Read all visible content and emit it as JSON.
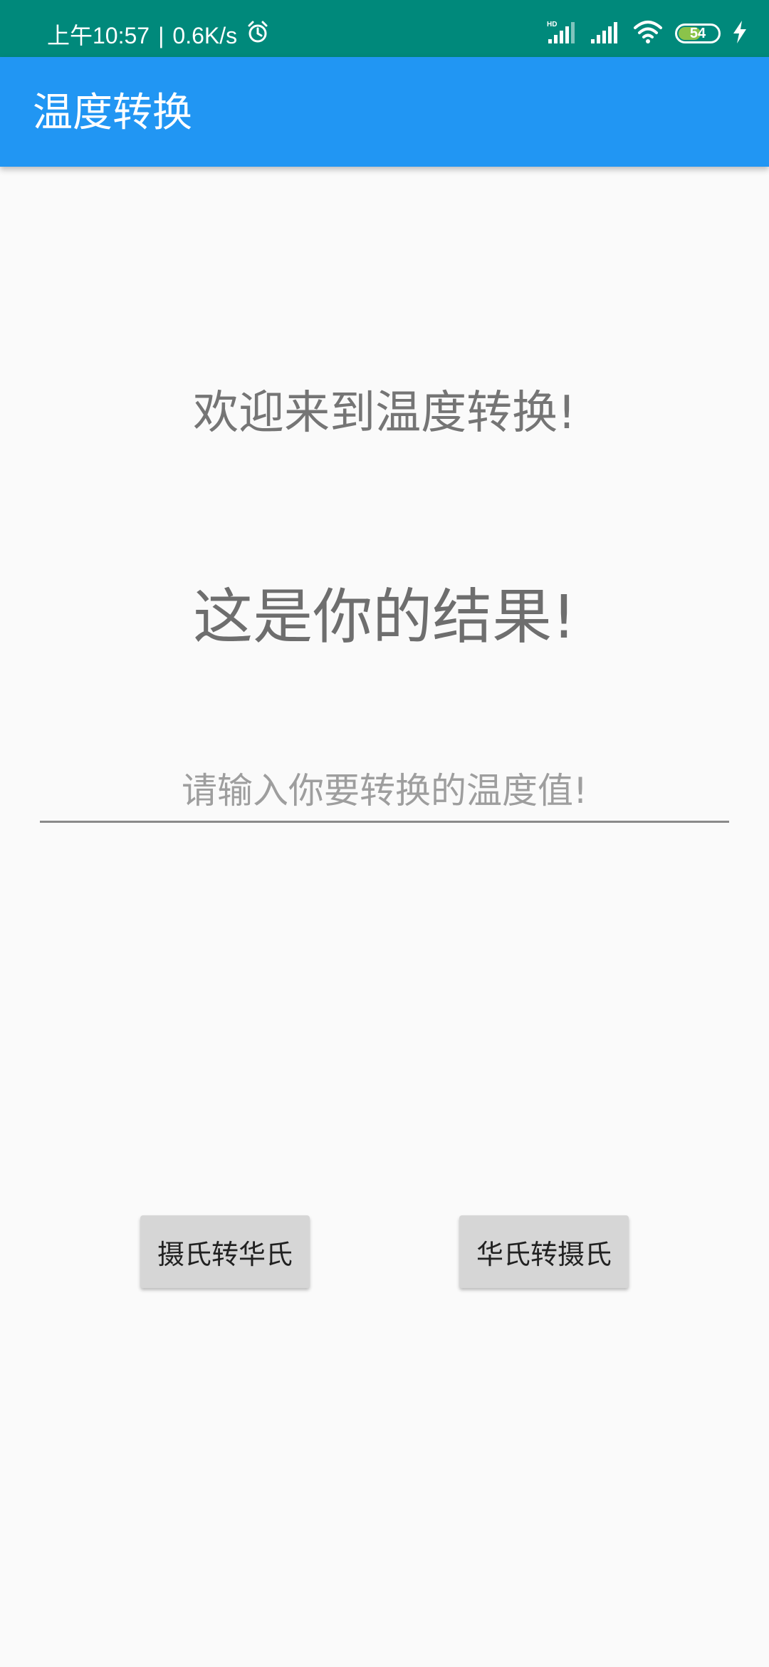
{
  "status_bar": {
    "time": "上午10:57",
    "separator": "|",
    "net_speed": "0.6K/s",
    "battery": "54",
    "battery_level": 0.54,
    "icons": [
      "alarm-icon",
      "signal-hd-icon",
      "signal-icon",
      "wifi-icon",
      "battery-icon",
      "charging-icon"
    ]
  },
  "app_bar": {
    "title": "温度转换"
  },
  "main": {
    "welcome": "欢迎来到温度转换!",
    "result": "这是你的结果!",
    "input_value": "",
    "input_placeholder": "请输入你要转换的温度值!"
  },
  "buttons": {
    "c2f": "摄氏转华氏",
    "f2c": "华氏转摄氏"
  },
  "colors": {
    "status_bar": "#00897b",
    "app_bar": "#2196f3",
    "background": "#fafafa",
    "button": "#d6d6d6",
    "battery_fill": "#8bc34a"
  }
}
